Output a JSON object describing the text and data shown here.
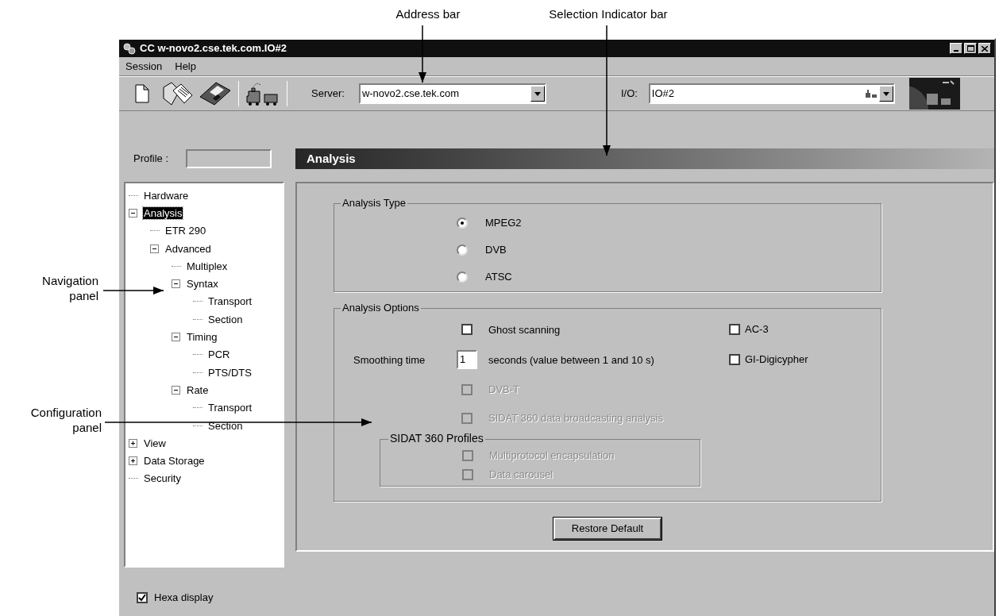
{
  "annotations": [
    {
      "kind": "top",
      "lines": [
        "Address bar"
      ]
    },
    {
      "kind": "top",
      "lines": [
        "Selection Indicator bar"
      ]
    },
    {
      "kind": "side",
      "lines": [
        "Navigation",
        "panel"
      ]
    },
    {
      "kind": "side",
      "lines": [
        "Configuration",
        "panel"
      ]
    }
  ],
  "window": {
    "title": "CC w-novo2.cse.tek.com.IO#2"
  },
  "menu": [
    "Session",
    "Help"
  ],
  "toolbar": {
    "server": {
      "label": "Server:",
      "value": "w-novo2.cse.tek.com"
    },
    "io": {
      "label": "I/O:",
      "value": "IO#2"
    }
  },
  "profile": {
    "label": "Profile :"
  },
  "tree": [
    {
      "label": "Hardware",
      "selected": false
    },
    {
      "label": "Analysis",
      "selected": true,
      "expanded": true,
      "children": [
        {
          "label": "ETR 290",
          "selected": false
        },
        {
          "label": "Advanced",
          "selected": false,
          "expanded": true,
          "children": [
            {
              "label": "Multiplex",
              "selected": false
            },
            {
              "label": "Syntax",
              "selected": false,
              "expanded": true,
              "children": [
                {
                  "label": "Transport",
                  "selected": false
                },
                {
                  "label": "Section",
                  "selected": false
                }
              ]
            },
            {
              "label": "Timing",
              "selected": false,
              "expanded": true,
              "children": [
                {
                  "label": "PCR",
                  "selected": false
                },
                {
                  "label": "PTS/DTS",
                  "selected": false
                }
              ]
            },
            {
              "label": "Rate",
              "selected": false,
              "expanded": true,
              "children": [
                {
                  "label": "Transport",
                  "selected": false
                },
                {
                  "label": "Section",
                  "selected": false
                }
              ]
            }
          ]
        }
      ]
    },
    {
      "label": "View",
      "selected": false,
      "expanded": false
    },
    {
      "label": "Data Storage",
      "selected": false,
      "expanded": false
    },
    {
      "label": "Security",
      "selected": false
    }
  ],
  "header": "Analysis",
  "analysis_type": {
    "title": "Analysis Type",
    "options": [
      {
        "label": "MPEG2",
        "selected": true
      },
      {
        "label": "DVB",
        "selected": false
      },
      {
        "label": "ATSC",
        "selected": false
      }
    ]
  },
  "analysis_options": {
    "title": "Analysis Options",
    "ghost_scanning": {
      "label": "Ghost scanning",
      "checked": false,
      "disabled": false
    },
    "ac3": {
      "label": "AC-3",
      "checked": false,
      "disabled": false
    },
    "smoothing_time": {
      "label": "Smoothing time",
      "value": "1",
      "unit": "seconds (value between 1 and 10 s)"
    },
    "gi_digicypher": {
      "label": "GI-Digicypher",
      "checked": false,
      "disabled": false
    },
    "dvb_t": {
      "label": "DVB-T",
      "checked": false,
      "disabled": true
    },
    "sidat_analysis": {
      "label": "SIDAT 360 data broadcasting analysis",
      "checked": false,
      "disabled": true
    },
    "sidat_profiles": {
      "title": "SIDAT 360 Profiles",
      "options": [
        {
          "label": "Multiprotocol encapsulation",
          "checked": false,
          "disabled": true
        },
        {
          "label": "Data carousel",
          "checked": false,
          "disabled": true
        }
      ]
    }
  },
  "restore_button": "Restore Default",
  "hexa_display": {
    "label": "Hexa display",
    "checked": true,
    "disabled": false
  }
}
